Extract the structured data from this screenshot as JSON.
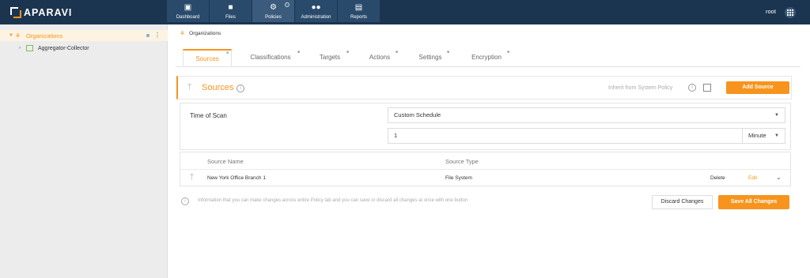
{
  "brand": {
    "name": "APARAVI"
  },
  "nav": [
    {
      "label": "Dashboard",
      "icon": "dashboard-icon"
    },
    {
      "label": "Files",
      "icon": "folder-icon"
    },
    {
      "label": "Policies",
      "icon": "gear-icon",
      "active": true
    },
    {
      "label": "Administration",
      "icon": "users-icon"
    },
    {
      "label": "Reports",
      "icon": "clipboard-icon"
    }
  ],
  "user": {
    "name": "root"
  },
  "sidebar": {
    "root": {
      "label": "Organizations"
    },
    "child": {
      "label": "Aggregator-Collector"
    }
  },
  "breadcrumb": {
    "label": "Organizations"
  },
  "tabs": [
    {
      "label": "Sources",
      "active": true
    },
    {
      "label": "Classifications"
    },
    {
      "label": "Targets"
    },
    {
      "label": "Actions"
    },
    {
      "label": "Settings"
    },
    {
      "label": "Encryption"
    }
  ],
  "sources": {
    "title": "Sources",
    "inherit_label": "Inherit from System Policy",
    "add_button": "Add Source",
    "time_of_scan_label": "Time of Scan",
    "schedule_value": "Custom Schedule",
    "interval_value": "1",
    "unit_value": "Minute",
    "columns": [
      "Source Name",
      "Source Type"
    ],
    "rows": [
      {
        "name": "New York Office Branch 1",
        "type": "File System",
        "delete": "Delete",
        "edit": "Edit"
      }
    ]
  },
  "footer": {
    "info_text": "Information that you can make changes across entire Policy tab and you can save or discard all changes at once with one button",
    "discard_button": "Discard Changes",
    "save_button": "Save All Changes"
  },
  "colors": {
    "accent": "#f7941d",
    "topbar": "#1b3550"
  }
}
